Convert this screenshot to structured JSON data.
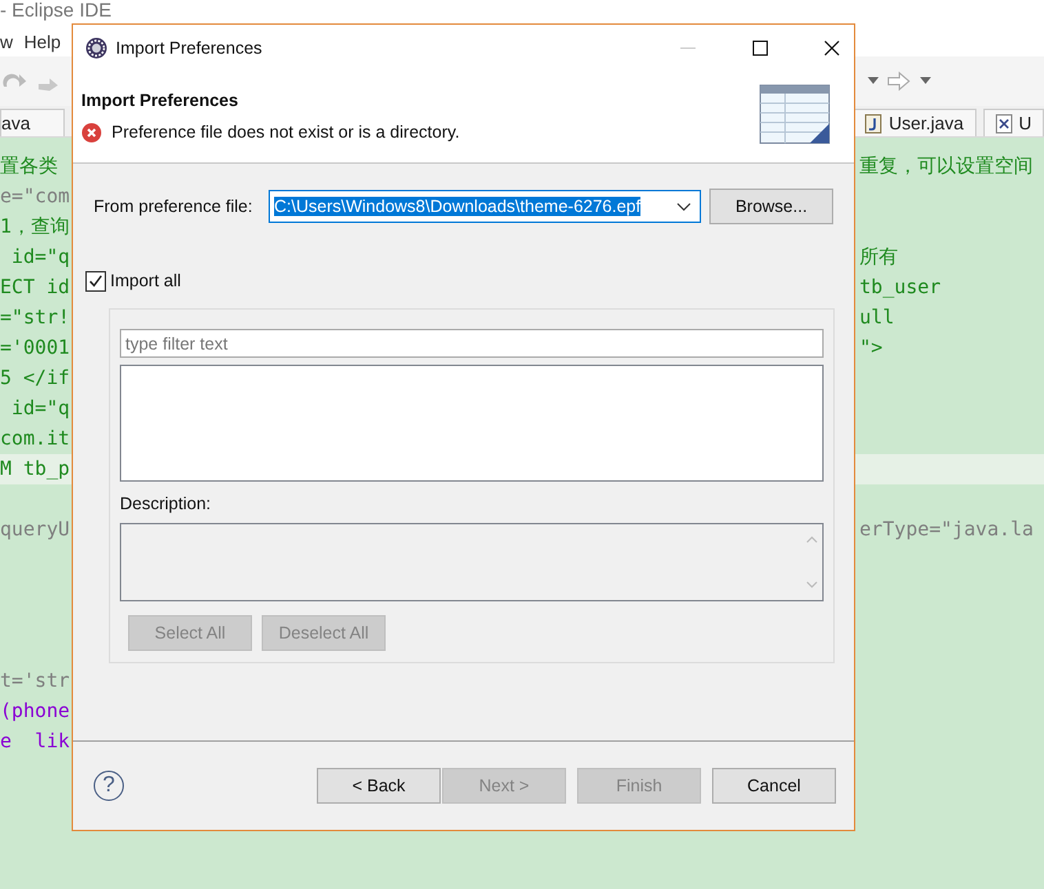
{
  "ide": {
    "title": "- Eclipse IDE",
    "menu": [
      "w",
      "Help"
    ],
    "tabs": [
      {
        "label": "ava",
        "kind": "plain"
      },
      {
        "label": "User.java",
        "kind": "java"
      },
      {
        "label": "U",
        "kind": "xml"
      }
    ]
  },
  "code_rows": [
    {
      "left": "置各类",
      "right": "重复，可以设置空间",
      "color": "#1f8a1f",
      "highlighted": false
    },
    {
      "left": "e=\"com",
      "color": "#7f7f7f",
      "highlighted": false
    },
    {
      "left": "1，查询",
      "color": "#1f8a1f",
      "highlighted": false
    },
    {
      "left": " id=\"q",
      "right": "所有",
      "color": "#1f8a1f",
      "highlighted": false
    },
    {
      "left": "ECT id",
      "right": "tb_user",
      "color": "#1f8a1f",
      "highlighted": false
    },
    {
      "left": "=\"str!",
      "right": "ull",
      "color": "#1f8a1f",
      "highlighted": false
    },
    {
      "left": "='0001",
      "right": "\">",
      "color": "#1f8a1f",
      "highlighted": false
    },
    {
      "left": "5 </if",
      "color": "#1f8a1f",
      "highlighted": false
    },
    {
      "left": " id=\"q",
      "color": "#1f8a1f",
      "highlighted": false
    },
    {
      "left": "com.it",
      "color": "#1f8a1f",
      "highlighted": false
    },
    {
      "left": "M tb_p",
      "color": "#1f8a1f",
      "highlighted": true
    },
    {
      "highlighted": false
    },
    {
      "left": "queryU",
      "right": "erType=\"java.la",
      "color": "#7f7f7f",
      "highlighted": false
    },
    {
      "highlighted": false
    },
    {
      "highlighted": false
    },
    {
      "highlighted": false
    },
    {
      "highlighted": false
    },
    {
      "left": "t='str",
      "color": "#7f7f7f",
      "highlighted": false
    },
    {
      "left": "(phone",
      "color": "#8a00d4",
      "highlighted": false
    },
    {
      "left": "e  lik",
      "color": "#8a00d4",
      "highlighted": false
    }
  ],
  "dialog": {
    "title": "Import Preferences",
    "header": {
      "title": "Import Preferences",
      "message": "Preference file does not exist or is a directory."
    },
    "file_label": "From preference file:",
    "file_value": "C:\\Users\\Windows8\\Downloads\\theme-6276.epf",
    "value_selected": true,
    "browse": "Browse...",
    "import_all": {
      "label": "Import all",
      "checked": true
    },
    "filter": {
      "placeholder": "type filter text"
    },
    "description_label": "Description:",
    "group_buttons": [
      {
        "label": "Select All",
        "disabled": true
      },
      {
        "label": "Deselect All",
        "disabled": true
      }
    ],
    "help_button": "?",
    "footer_buttons": [
      {
        "label": "< Back",
        "disabled": false
      },
      {
        "label": "Next >",
        "disabled": true
      },
      {
        "label": "Finish",
        "disabled": true
      },
      {
        "label": "Cancel",
        "disabled": false
      }
    ]
  }
}
